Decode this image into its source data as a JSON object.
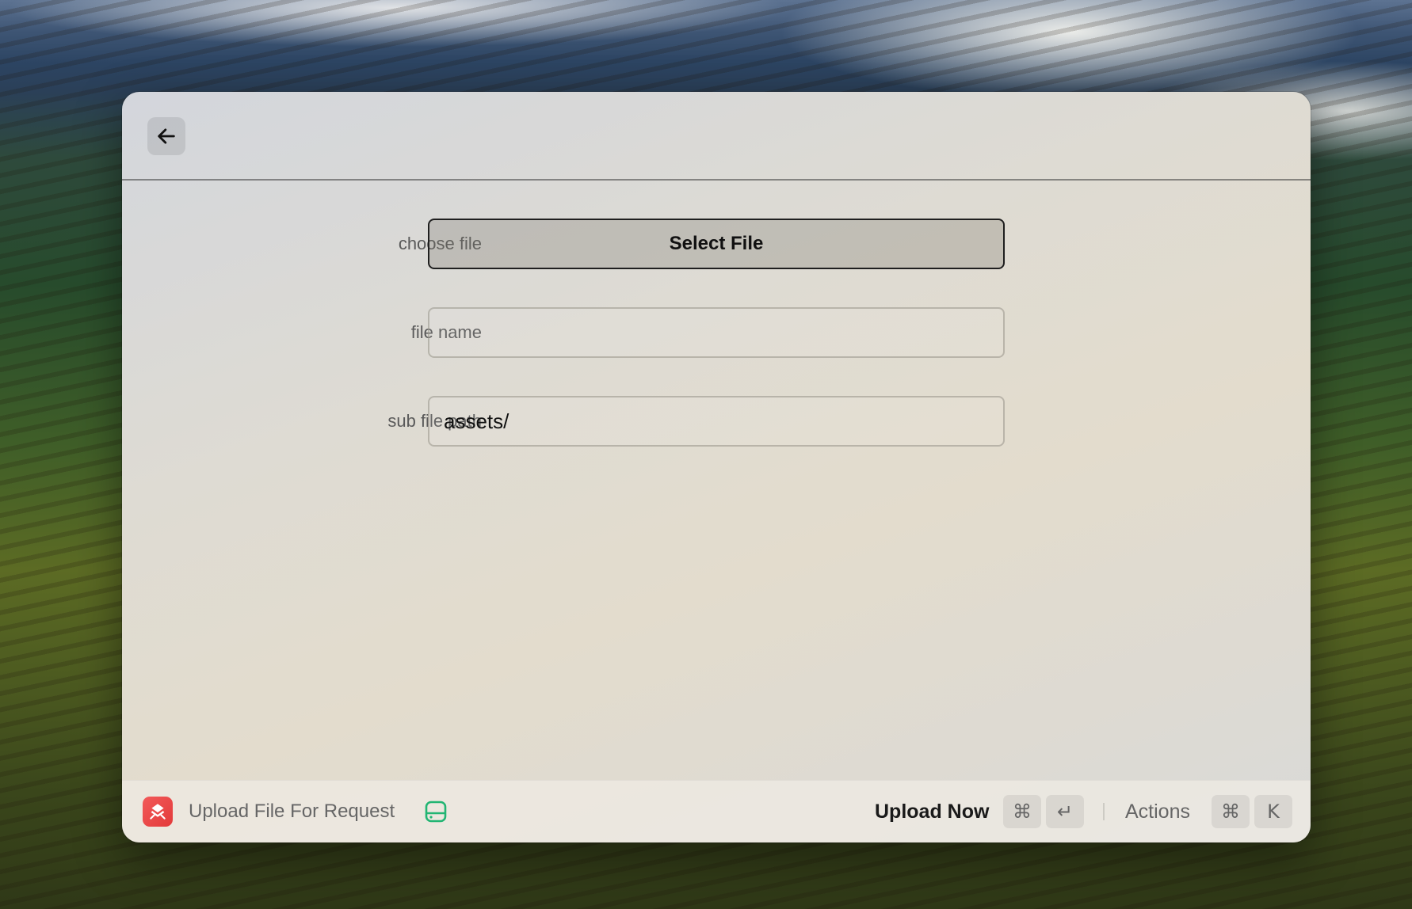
{
  "form": {
    "choose_file": {
      "label": "choose file",
      "button_label": "Select File"
    },
    "file_name": {
      "label": "file name",
      "value": "",
      "placeholder": ""
    },
    "sub_file_path": {
      "label": "sub file path",
      "value": "assets/"
    }
  },
  "footer": {
    "title": "Upload File For Request",
    "primary_action": "Upload Now",
    "primary_shortcut": [
      "⌘",
      "↵"
    ],
    "actions_label": "Actions",
    "actions_shortcut": [
      "⌘",
      "K"
    ]
  },
  "icons": {
    "back": "arrow-left-icon",
    "extension": "extension-logo-icon",
    "storage": "hard-drive-icon"
  },
  "colors": {
    "extension_icon": "#e8403f",
    "storage_icon": "#22b573"
  }
}
